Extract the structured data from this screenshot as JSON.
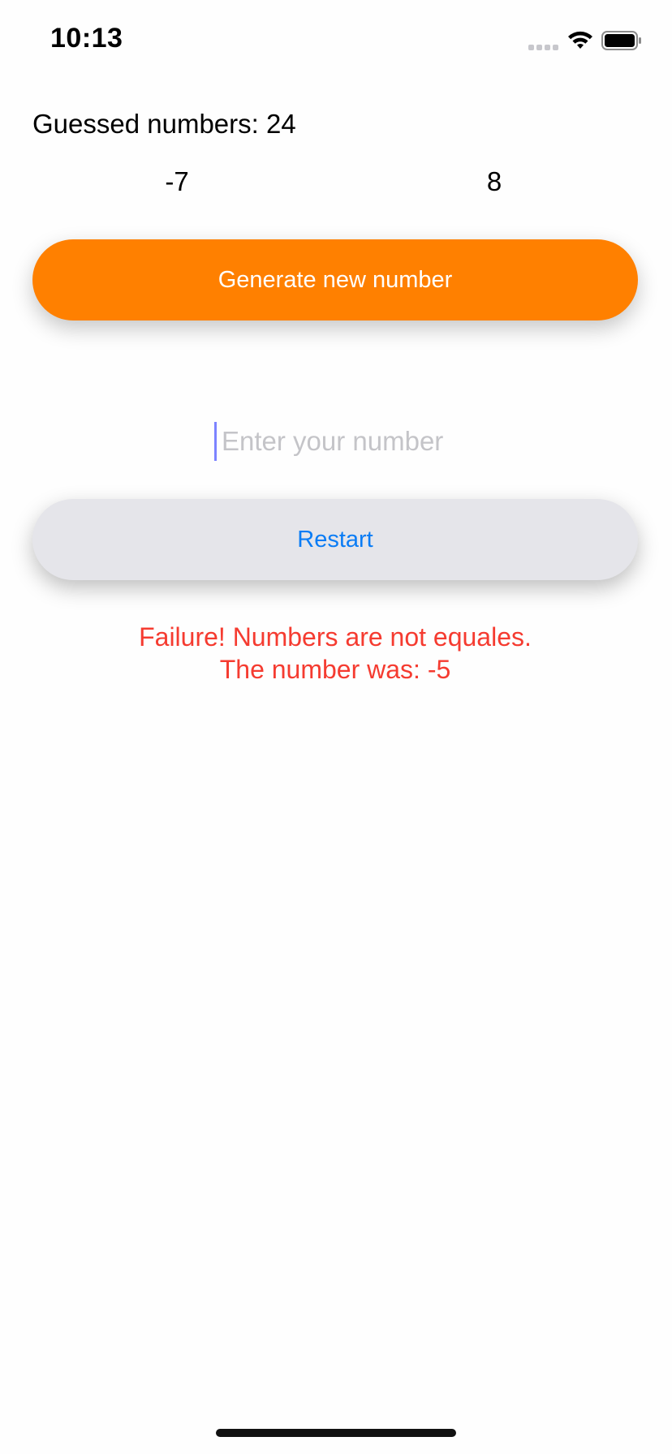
{
  "status_bar": {
    "time": "10:13",
    "icons": [
      "cellular-signal-icon",
      "wifi-icon",
      "battery-icon"
    ]
  },
  "game": {
    "guessed_label": "Guessed numbers: 24",
    "range_min": "-7",
    "range_max": "8"
  },
  "buttons": {
    "generate_label": "Generate new number",
    "restart_label": "Restart"
  },
  "input": {
    "value": "",
    "placeholder": "Enter your number"
  },
  "result": {
    "line1": "Failure! Numbers are not equales.",
    "line2": "The number was: -5"
  },
  "colors": {
    "accent_orange": "#ff8000",
    "link_blue": "#0a7cf5",
    "error_red": "#f53b30",
    "restart_bg": "#e5e5ea"
  }
}
